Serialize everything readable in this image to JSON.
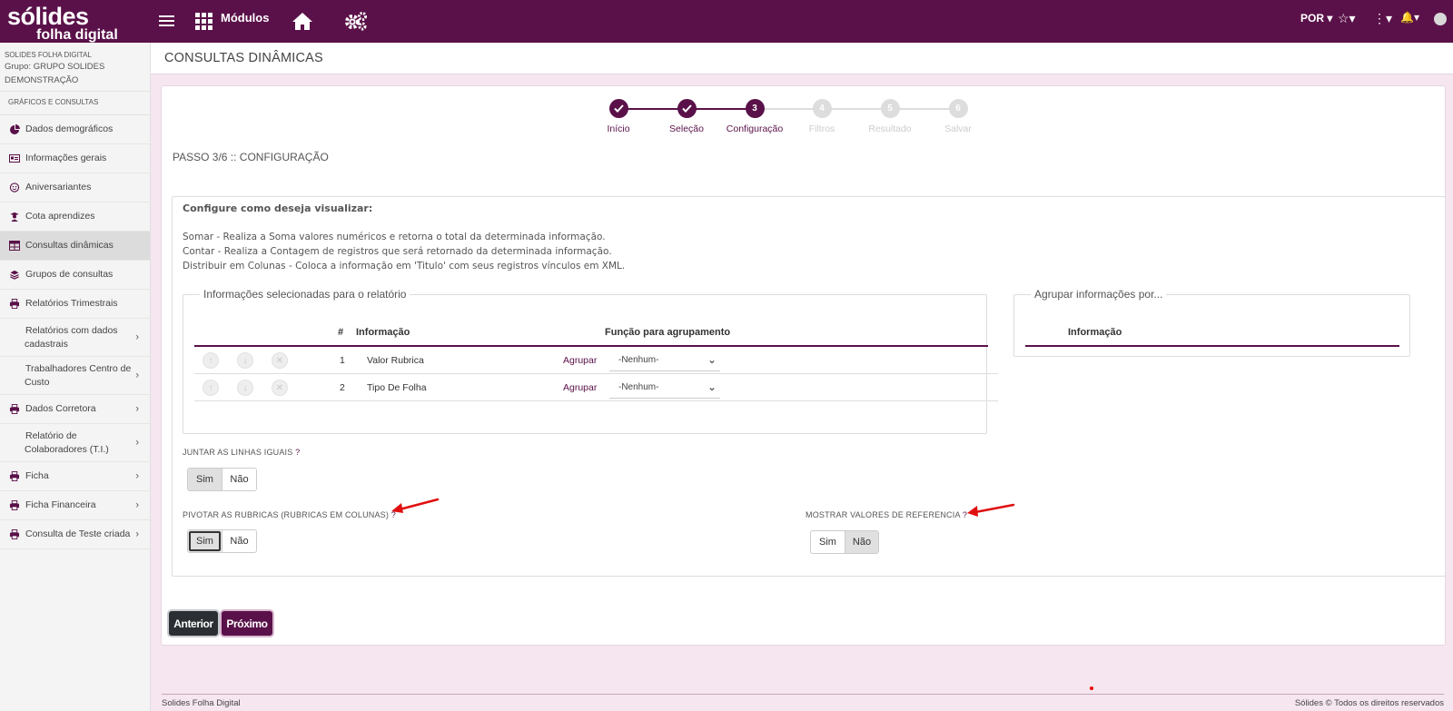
{
  "brand": {
    "line1": "sólides",
    "line2": "folha digital"
  },
  "topbar": {
    "modules_label": "Módulos",
    "language": "POR ▾",
    "star": "☆▾",
    "more": "⋮▾",
    "bell": "🔔▾"
  },
  "sidebar": {
    "org_name": "SOLIDES FOLHA DIGITAL",
    "group_label": "Grupo:",
    "group_name": "GRUPO SOLIDES DEMONSTRAÇÃO",
    "section": "GRÁFICOS E CONSULTAS",
    "items": [
      {
        "label": "Dados demográficos",
        "icon": "pie-chart-icon"
      },
      {
        "label": "Informações gerais",
        "icon": "id-card-icon"
      },
      {
        "label": "Aniversariantes",
        "icon": "smile-icon"
      },
      {
        "label": "Cota aprendizes",
        "icon": "user-graduate-icon"
      },
      {
        "label": "Consultas dinâmicas",
        "icon": "table-icon",
        "active": true
      },
      {
        "label": "Grupos de consultas",
        "icon": "layers-icon"
      },
      {
        "label": "Relatórios Trimestrais",
        "icon": "printer-icon"
      },
      {
        "label": "Relatórios com dados cadastrais",
        "icon": "printer-icon",
        "submenu": true
      },
      {
        "label": "Trabalhadores Centro de Custo",
        "icon": "printer-icon",
        "submenu": true
      },
      {
        "label": "Dados Corretora",
        "icon": "printer-icon",
        "submenu": true
      },
      {
        "label": "Relatório de Colaboradores (T.I.)",
        "icon": "printer-icon",
        "submenu": true
      },
      {
        "label": "Ficha",
        "icon": "printer-icon",
        "submenu": true
      },
      {
        "label": "Ficha Financeira",
        "icon": "printer-icon",
        "submenu": true
      },
      {
        "label": "Consulta de Teste criada",
        "icon": "printer-icon",
        "submenu": true
      }
    ]
  },
  "page": {
    "title": "CONSULTAS DINÂMICAS"
  },
  "stepper": {
    "steps": [
      {
        "label": "Início",
        "num": "1",
        "state": "done"
      },
      {
        "label": "Seleção",
        "num": "2",
        "state": "done"
      },
      {
        "label": "Configuração",
        "num": "3",
        "state": "current"
      },
      {
        "label": "Filtros",
        "num": "4",
        "state": "todo"
      },
      {
        "label": "Resultado",
        "num": "5",
        "state": "todo"
      },
      {
        "label": "Salvar",
        "num": "6",
        "state": "todo"
      }
    ]
  },
  "step_title": "PASSO 3/6 :: CONFIGURAÇÃO",
  "config": {
    "title": "Configure como deseja visualizar:",
    "desc": [
      "Somar - Realiza a Soma valores numéricos e retorna o total da determinada informação.",
      "Contar - Realiza a Contagem de registros que será retornado da determinada informação.",
      "Distribuir em Colunas - Coloca a informação em 'Titulo' com seus registros vínculos em XML."
    ]
  },
  "selected": {
    "legend": "Informações selecionadas para o relatório",
    "col_num": "#",
    "col_info": "Informação",
    "col_func": "Função para agrupamento",
    "rows": [
      {
        "num": "1",
        "info": "Valor Rubrica",
        "group_link": "Agrupar",
        "func": "-Nenhum-"
      },
      {
        "num": "2",
        "info": "Tipo De Folha",
        "group_link": "Agrupar",
        "func": "-Nenhum-"
      }
    ]
  },
  "groupby": {
    "legend": "Agrupar informações por...",
    "col_info": "Informação"
  },
  "questions": {
    "join": {
      "label": "JUNTAR AS LINHAS IGUAIS",
      "q": "?",
      "yes": "Sim",
      "no": "Não",
      "value": "Sim"
    },
    "pivot": {
      "label": "PIVOTAR AS RUBRICAS (RUBRICAS EM COLUNAS)",
      "q": "?",
      "yes": "Sim",
      "no": "Não",
      "value": "Sim"
    },
    "ref": {
      "label": "MOSTRAR VALORES DE REFERENCIA",
      "q": "?",
      "yes": "Sim",
      "no": "Não",
      "value": "Não"
    }
  },
  "buttons": {
    "prev": "Anterior",
    "next": "Próximo"
  },
  "footer": {
    "left": "Solides Folha Digital",
    "right": "Sólides © Todos os direitos reservados"
  },
  "colors": {
    "brand": "#5a1149",
    "annotation": "#e01010"
  }
}
